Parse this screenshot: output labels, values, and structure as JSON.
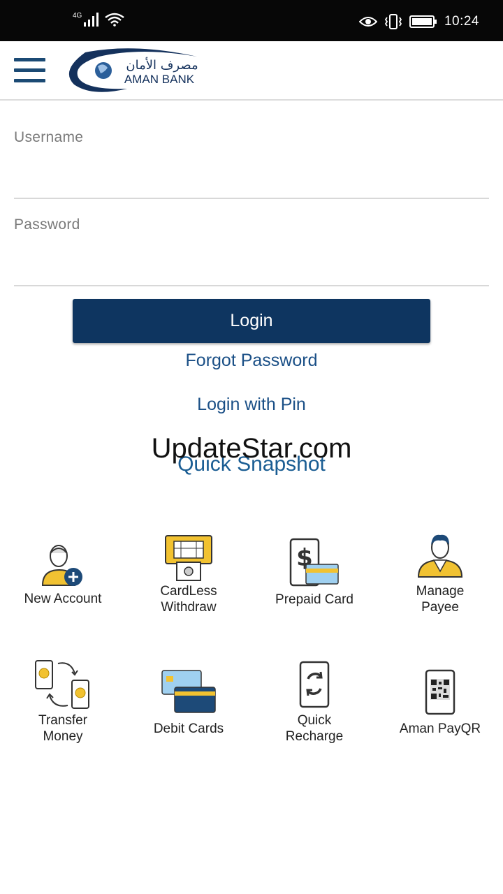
{
  "status_bar": {
    "network": "4G",
    "time": "10:24"
  },
  "header": {
    "logo_text_en": "AMAN BANK",
    "logo_text_ar": "مصرف الأمان"
  },
  "login_form": {
    "username_label": "Username",
    "password_label": "Password",
    "login_label": "Login",
    "forgot_password": "Forgot Password",
    "login_with_pin": "Login with Pin",
    "quick_snapshot": "Quick Snapshot"
  },
  "watermark": "UpdateStar.com",
  "services": [
    {
      "label": "New Account",
      "icon": "new-account-icon"
    },
    {
      "label": "CardLess\nWithdraw",
      "icon": "atm-icon"
    },
    {
      "label": "Prepaid Card",
      "icon": "prepaid-card-icon"
    },
    {
      "label": "Manage\nPayee",
      "icon": "payee-icon"
    },
    {
      "label": "Transfer\nMoney",
      "icon": "transfer-icon"
    },
    {
      "label": "Debit Cards",
      "icon": "debit-cards-icon"
    },
    {
      "label": "Quick\nRecharge",
      "icon": "recharge-icon"
    },
    {
      "label": "Aman PayQR",
      "icon": "qr-code-icon"
    }
  ]
}
